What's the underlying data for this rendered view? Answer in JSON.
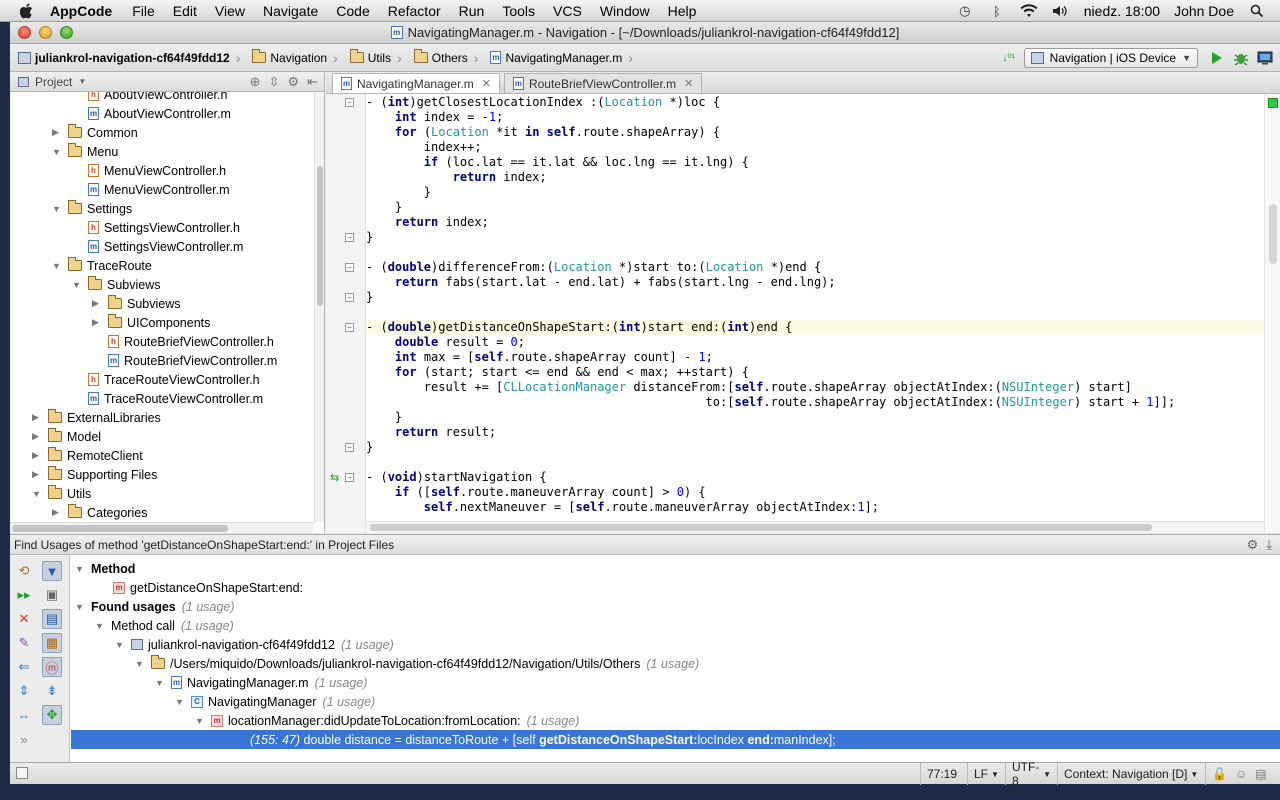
{
  "menubar": {
    "app_name": "AppCode",
    "items": [
      "File",
      "Edit",
      "View",
      "Navigate",
      "Code",
      "Refactor",
      "Run",
      "Tools",
      "VCS",
      "Window",
      "Help"
    ],
    "clock": "niedz. 18:00",
    "user": "John Doe"
  },
  "window": {
    "title": "NavigatingManager.m - Navigation - [~/Downloads/juliankrol-navigation-cf64f49fdd12]"
  },
  "breadcrumbs": [
    "juliankrol-navigation-cf64f49fdd12",
    "Navigation",
    "Utils",
    "Others",
    "NavigatingManager.m"
  ],
  "run_config": "Navigation | iOS Device",
  "project_panel": {
    "title": "Project",
    "tree": [
      {
        "label": "AboutViewController.h",
        "type": "h",
        "depth": 4,
        "arrow": ""
      },
      {
        "label": "AboutViewController.m",
        "type": "m",
        "depth": 4,
        "arrow": ""
      },
      {
        "label": "Common",
        "type": "folder",
        "depth": 3,
        "arrow": "right"
      },
      {
        "label": "Menu",
        "type": "folder",
        "depth": 3,
        "arrow": "down"
      },
      {
        "label": "MenuViewController.h",
        "type": "h",
        "depth": 4,
        "arrow": ""
      },
      {
        "label": "MenuViewController.m",
        "type": "m",
        "depth": 4,
        "arrow": ""
      },
      {
        "label": "Settings",
        "type": "folder",
        "depth": 3,
        "arrow": "down"
      },
      {
        "label": "SettingsViewController.h",
        "type": "h",
        "depth": 4,
        "arrow": ""
      },
      {
        "label": "SettingsViewController.m",
        "type": "m",
        "depth": 4,
        "arrow": ""
      },
      {
        "label": "TraceRoute",
        "type": "folder",
        "depth": 3,
        "arrow": "down"
      },
      {
        "label": "Subviews",
        "type": "folder",
        "depth": 4,
        "arrow": "down"
      },
      {
        "label": "Subviews",
        "type": "folder",
        "depth": 5,
        "arrow": "right"
      },
      {
        "label": "UIComponents",
        "type": "folder",
        "depth": 5,
        "arrow": "right"
      },
      {
        "label": "RouteBriefViewController.h",
        "type": "h",
        "depth": 5,
        "arrow": ""
      },
      {
        "label": "RouteBriefViewController.m",
        "type": "m",
        "depth": 5,
        "arrow": ""
      },
      {
        "label": "TraceRouteViewController.h",
        "type": "h",
        "depth": 4,
        "arrow": ""
      },
      {
        "label": "TraceRouteViewController.m",
        "type": "m",
        "depth": 4,
        "arrow": ""
      },
      {
        "label": "ExternalLibraries",
        "type": "folder",
        "depth": 2,
        "arrow": "right"
      },
      {
        "label": "Model",
        "type": "folder",
        "depth": 2,
        "arrow": "right"
      },
      {
        "label": "RemoteClient",
        "type": "folder",
        "depth": 2,
        "arrow": "right"
      },
      {
        "label": "Supporting Files",
        "type": "folder",
        "depth": 2,
        "arrow": "right"
      },
      {
        "label": "Utils",
        "type": "folder",
        "depth": 2,
        "arrow": "down"
      },
      {
        "label": "Categories",
        "type": "folder",
        "depth": 3,
        "arrow": "right"
      }
    ]
  },
  "editor": {
    "tabs": [
      {
        "label": "NavigatingManager.m",
        "active": true
      },
      {
        "label": "RouteBriefViewController.m",
        "active": false
      }
    ],
    "code": [
      "- (int)getClosestLocationIndex :(Location *)loc {",
      "    int index = -1;",
      "    for (Location *it in self.route.shapeArray) {",
      "        index++;",
      "        if (loc.lat == it.lat && loc.lng == it.lng) {",
      "            return index;",
      "        }",
      "    }",
      "    return index;",
      "}",
      "",
      "- (double)differenceFrom:(Location *)start to:(Location *)end {",
      "    return fabs(start.lat - end.lat) + fabs(start.lng - end.lng);",
      "}",
      "",
      "- (double)getDistanceOnShapeStart:(int)start end:(int)end {",
      "    double result = 0;",
      "    int max = [self.route.shapeArray count] - 1;",
      "    for (start; start <= end && end < max; ++start) {",
      "        result += [CLLocationManager distanceFrom:[self.route.shapeArray objectAtIndex:(NSUInteger) start]",
      "                                               to:[self.route.shapeArray objectAtIndex:(NSUInteger) start + 1]];",
      "    }",
      "    return result;",
      "}",
      "",
      "- (void)startNavigation {",
      "    if ([self.route.maneuverArray count] > 0) {",
      "        self.nextManeuver = [self.route.maneuverArray objectAtIndex:1];"
    ],
    "highlight_line": 15
  },
  "find_panel": {
    "title": "Find Usages of method 'getDistanceOnShapeStart:end:' in Project Files",
    "method_header": "Method",
    "method_name": "getDistanceOnShapeStart:end:",
    "found_usages": "Found usages",
    "found_count": "(1 usage)",
    "method_call": "Method call",
    "method_call_count": "(1 usage)",
    "project": "juliankrol-navigation-cf64f49fdd12",
    "project_count": "(1 usage)",
    "directory": "/Users/miquido/Downloads/juliankrol-navigation-cf64f49fdd12/Navigation/Utils/Others",
    "directory_count": "(1 usage)",
    "file": "NavigatingManager.m",
    "file_count": "(1 usage)",
    "class": "NavigatingManager",
    "class_count": "(1 usage)",
    "caller": "locationManager:didUpdateToLocation:fromLocation:",
    "caller_count": "(1 usage)",
    "usage_position": "(155: 47)",
    "usage_pre": " double distance = distanceToRoute + [self ",
    "usage_match_1": "getDistanceOnShapeStart:",
    "usage_mid": "locIndex ",
    "usage_match_2": "end:",
    "usage_post": "manIndex];"
  },
  "status": {
    "position": "77:19",
    "line_sep": "LF",
    "encoding": "UTF-8",
    "context": "Context: Navigation [D]"
  }
}
